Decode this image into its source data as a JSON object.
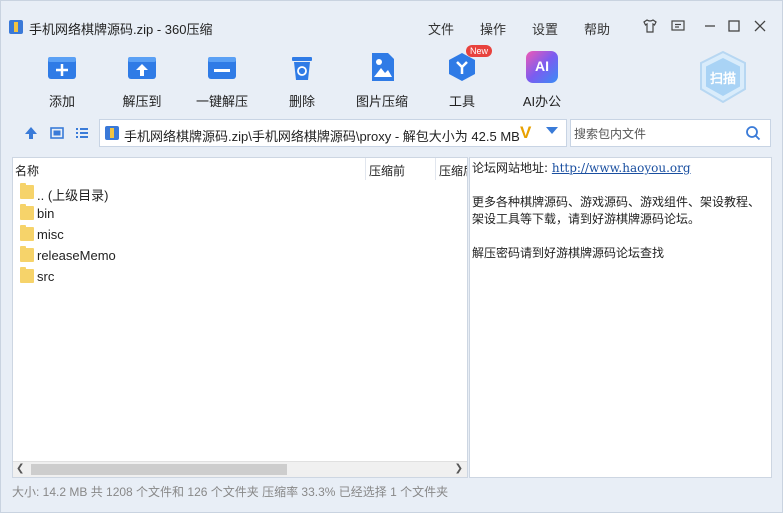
{
  "window": {
    "title": "手机网络棋牌源码.zip - 360压缩",
    "menu": [
      "文件",
      "操作",
      "设置",
      "帮助"
    ]
  },
  "toolbar": {
    "items": [
      {
        "label": "添加",
        "icon": "add-icon"
      },
      {
        "label": "解压到",
        "icon": "extract-to-icon"
      },
      {
        "label": "一键解压",
        "icon": "one-click-extract-icon"
      },
      {
        "label": "删除",
        "icon": "delete-icon"
      },
      {
        "label": "图片压缩",
        "icon": "image-compress-icon"
      },
      {
        "label": "工具",
        "icon": "tools-icon",
        "badge": "New"
      },
      {
        "label": "AI办公",
        "icon": "ai-office-icon",
        "icon_text": "AI"
      }
    ],
    "scan_label": "扫描"
  },
  "address": {
    "path": "手机网络棋牌源码.zip\\手机网络棋牌源码\\proxy - 解包大小为 42.5 MB",
    "v_badge": "V"
  },
  "search": {
    "placeholder": "搜索包内文件"
  },
  "file_list": {
    "columns": [
      "名称",
      "压缩前",
      "压缩后"
    ],
    "rows": [
      ".. (上级目录)",
      "bin",
      "misc",
      "releaseMemo",
      "src"
    ]
  },
  "info": {
    "forum_prefix": "论坛网站地址: ",
    "forum_url": "http://www.haoyou.org",
    "line1": "更多各种棋牌源码、游戏源码、游戏组件、架设教程、",
    "line2": "架设工具等下载，请到好游棋牌源码论坛。",
    "line3": "解压密码请到好游棋牌源码论坛查找"
  },
  "status": {
    "text": "大小: 14.2 MB 共 1208 个文件和 126 个文件夹 压缩率 33.3% 已经选择 1 个文件夹"
  },
  "colors": {
    "accent": "#3a7bd8",
    "folder": "#f6d36a",
    "badge_red": "#e8423d"
  }
}
